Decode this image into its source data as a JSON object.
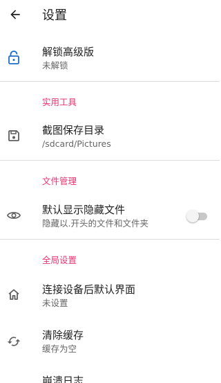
{
  "colors": {
    "accent": "#e8336f",
    "primary_blue": "#1e6fc8",
    "icon_gray": "#5f5f5f"
  },
  "appbar": {
    "title": "设置",
    "back_icon": "arrow-left-icon"
  },
  "unlock": {
    "icon": "unlock-icon",
    "title": "解锁高级版",
    "subtitle": "未解锁"
  },
  "sections": {
    "tools": "实用工具",
    "files": "文件管理",
    "global": "全局设置"
  },
  "screenshot_dir": {
    "icon": "floppy-disk-icon",
    "title": "截图保存目录",
    "subtitle": "/sdcard/Pictures"
  },
  "hidden_files": {
    "icon": "eye-icon",
    "title": "默认显示隐藏文件",
    "subtitle": "隐藏以.开头的文件和文件夹",
    "enabled": false
  },
  "default_ui": {
    "icon": "home-icon",
    "title": "连接设备后默认界面",
    "subtitle": "未设置"
  },
  "clear_cache": {
    "icon": "refresh-icon",
    "title": "清除缓存",
    "subtitle": "缓存为空"
  },
  "crash_log": {
    "title": "崩溃日志"
  }
}
